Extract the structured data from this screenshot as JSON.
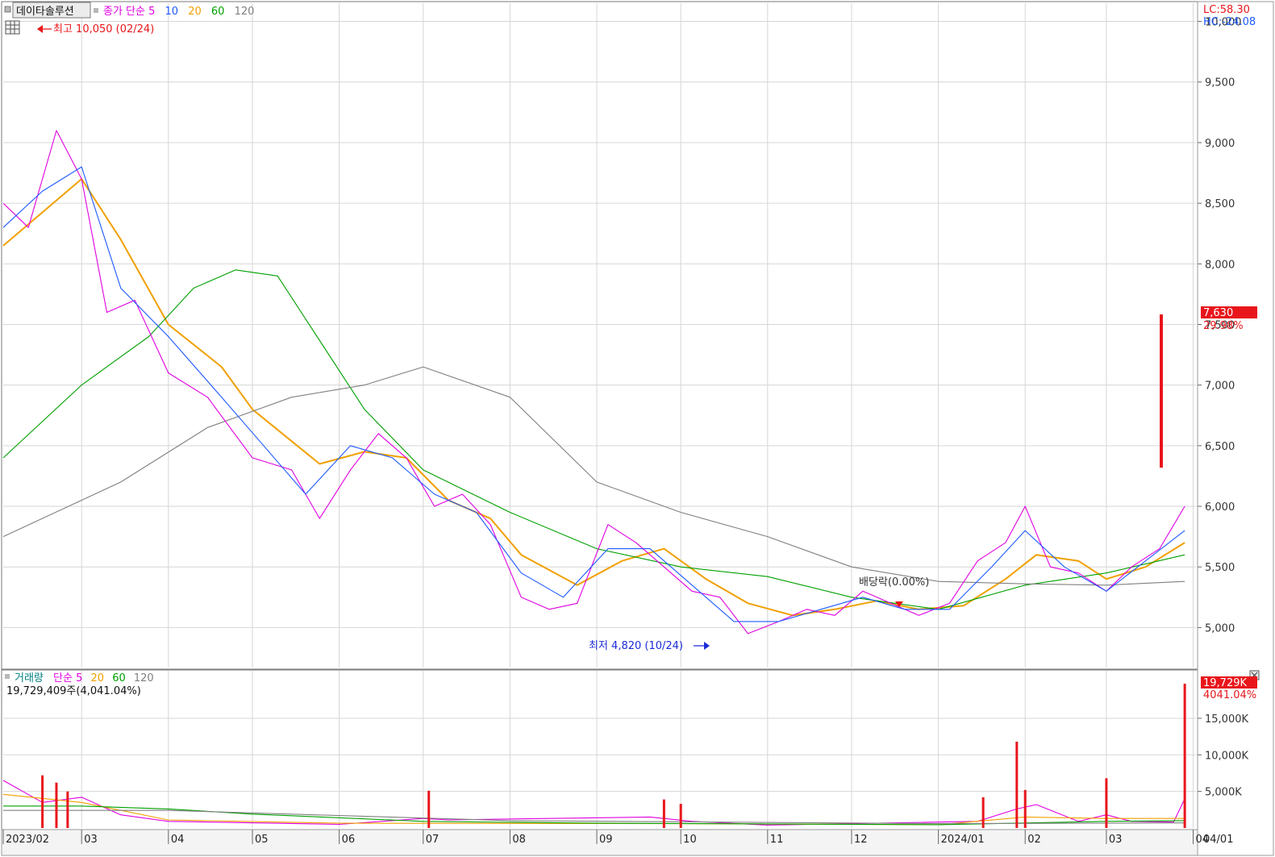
{
  "header": {
    "stock_name": "데이타솔루션",
    "price_legend": [
      {
        "text": "종가 단순 5",
        "color": "#e000e0"
      },
      {
        "text": "10",
        "color": "#1e5aff"
      },
      {
        "text": "20",
        "color": "#f0a000"
      },
      {
        "text": "60",
        "color": "#00a000"
      },
      {
        "text": "120",
        "color": "#808080"
      }
    ],
    "lc_label": "LC:58.30",
    "hc_label": "HC:-24.08"
  },
  "volume_header": {
    "legend": [
      {
        "text": "거래량",
        "color": "#008080"
      },
      {
        "text": "단순 5",
        "color": "#e000e0"
      },
      {
        "text": "20",
        "color": "#f0a000"
      },
      {
        "text": "60",
        "color": "#00a000"
      },
      {
        "text": "120",
        "color": "#808080"
      }
    ],
    "total": "19,729,409주(4,041.04%)"
  },
  "annotations": {
    "high": "최고 10,050 (02/24)",
    "low": "최저 4,820 (10/24)",
    "dividend": "배당락(0.00%)"
  },
  "price_tag": {
    "price": "7,630",
    "change": "29.98%"
  },
  "volume_tag": {
    "volume": "19,729K",
    "ratio": "4041.04%"
  },
  "colors": {
    "up": "#e8161b",
    "down": "#1a44d8",
    "ma5": "#e000e0",
    "ma10": "#1e5aff",
    "ma20": "#f0a000",
    "ma60": "#00a000",
    "ma120": "#808080"
  },
  "chart_data": [
    {
      "type": "line",
      "panel": "price",
      "y_ticks": [
        5000,
        5500,
        6000,
        6500,
        7000,
        7500,
        8000,
        8500,
        9000,
        9500,
        10000
      ],
      "y_tick_labels": [
        "5,000",
        "5,500",
        "6,000",
        "6,500",
        "7,000",
        "7,500",
        "8,000",
        "8,500",
        "9,000",
        "9,500",
        "10,000"
      ],
      "ylim": [
        4670,
        10150
      ],
      "x_ticks": [
        "2023/02",
        "03",
        "04",
        "05",
        "06",
        "07",
        "08",
        "09",
        "10",
        "11",
        "12",
        "2024/01",
        "02",
        "03",
        "04",
        "04/01"
      ],
      "series": [
        {
          "key": "ma20",
          "x": [
            "2023-02-01",
            "2023-03-01",
            "2023-03-15",
            "2023-04-01",
            "2023-04-20",
            "2023-05-01",
            "2023-05-25",
            "2023-06-10",
            "2023-06-25",
            "2023-07-10",
            "2023-07-25",
            "2023-08-05",
            "2023-08-25",
            "2023-09-10",
            "2023-09-25",
            "2023-10-10",
            "2023-10-25",
            "2023-11-10",
            "2023-11-25",
            "2023-12-10",
            "2023-12-25",
            "2024-01-10",
            "2024-01-25",
            "2024-02-05",
            "2024-02-20",
            "2024-03-01",
            "2024-03-15",
            "2024-03-29"
          ],
          "y": [
            8150,
            8700,
            8200,
            7500,
            7150,
            6800,
            6350,
            6450,
            6400,
            6050,
            5900,
            5600,
            5350,
            5550,
            5650,
            5400,
            5200,
            5100,
            5150,
            5220,
            5150,
            5180,
            5400,
            5600,
            5550,
            5400,
            5500,
            5700
          ]
        },
        {
          "key": "ma60",
          "x": [
            "2023-02-01",
            "2023-03-01",
            "2023-03-25",
            "2023-04-10",
            "2023-04-25",
            "2023-05-10",
            "2023-06-10",
            "2023-07-01",
            "2023-08-01",
            "2023-09-01",
            "2023-10-01",
            "2023-11-01",
            "2023-12-01",
            "2024-01-01",
            "2024-02-01",
            "2024-03-01",
            "2024-03-29"
          ],
          "y": [
            6400,
            7000,
            7400,
            7800,
            7950,
            7900,
            6800,
            6300,
            5950,
            5650,
            5500,
            5420,
            5250,
            5150,
            5350,
            5450,
            5600
          ]
        },
        {
          "key": "ma120",
          "x": [
            "2023-02-01",
            "2023-03-15",
            "2023-04-15",
            "2023-05-15",
            "2023-06-10",
            "2023-07-01",
            "2023-08-01",
            "2023-09-01",
            "2023-10-01",
            "2023-11-01",
            "2023-12-01",
            "2024-01-01",
            "2024-02-01",
            "2024-03-01",
            "2024-03-29"
          ],
          "y": [
            5750,
            6200,
            6650,
            6900,
            7000,
            7150,
            6900,
            6200,
            5950,
            5750,
            5500,
            5380,
            5360,
            5350,
            5380
          ]
        },
        {
          "key": "ma5",
          "x": [
            "2023-02-01",
            "2023-02-10",
            "2023-02-20",
            "2023-03-01",
            "2023-03-10",
            "2023-03-20",
            "2023-04-01",
            "2023-04-15",
            "2023-05-01",
            "2023-05-15",
            "2023-05-25",
            "2023-06-05",
            "2023-06-15",
            "2023-06-25",
            "2023-07-05",
            "2023-07-15",
            "2023-07-25",
            "2023-08-05",
            "2023-08-15",
            "2023-08-25",
            "2023-09-05",
            "2023-09-15",
            "2023-09-25",
            "2023-10-05",
            "2023-10-15",
            "2023-10-25",
            "2023-11-05",
            "2023-11-15",
            "2023-11-25",
            "2023-12-05",
            "2023-12-15",
            "2023-12-25",
            "2024-01-05",
            "2024-01-15",
            "2024-01-25",
            "2024-02-01",
            "2024-02-10",
            "2024-02-20",
            "2024-03-01",
            "2024-03-10",
            "2024-03-20",
            "2024-03-29"
          ],
          "y": [
            8500,
            8300,
            9100,
            8700,
            7600,
            7700,
            7100,
            6900,
            6400,
            6300,
            5900,
            6300,
            6600,
            6400,
            6000,
            6100,
            5850,
            5250,
            5150,
            5200,
            5850,
            5700,
            5500,
            5300,
            5250,
            4950,
            5050,
            5150,
            5100,
            5300,
            5200,
            5100,
            5200,
            5550,
            5700,
            6000,
            5500,
            5450,
            5300,
            5500,
            5650,
            6000
          ]
        },
        {
          "key": "ma10",
          "x": [
            "2023-02-01",
            "2023-02-15",
            "2023-03-01",
            "2023-03-15",
            "2023-04-01",
            "2023-04-20",
            "2023-05-05",
            "2023-05-20",
            "2023-06-05",
            "2023-06-20",
            "2023-07-05",
            "2023-07-20",
            "2023-08-05",
            "2023-08-20",
            "2023-09-05",
            "2023-09-20",
            "2023-10-05",
            "2023-10-20",
            "2023-11-05",
            "2023-11-20",
            "2023-12-05",
            "2023-12-20",
            "2024-01-05",
            "2024-01-20",
            "2024-02-01",
            "2024-02-15",
            "2024-03-01",
            "2024-03-15",
            "2024-03-29"
          ],
          "y": [
            8300,
            8600,
            8800,
            7800,
            7400,
            6900,
            6500,
            6100,
            6500,
            6400,
            6100,
            5950,
            5450,
            5250,
            5650,
            5650,
            5350,
            5050,
            5050,
            5150,
            5250,
            5150,
            5150,
            5500,
            5800,
            5500,
            5300,
            5550,
            5800
          ]
        }
      ],
      "annotations": [
        {
          "label": "high",
          "x": "2023-02-24",
          "y": 10050
        },
        {
          "label": "low",
          "x": "2023-10-24",
          "y": 4820
        },
        {
          "label": "dividend",
          "x": "2023-12-27",
          "y": 5180
        }
      ],
      "last_close": 7630
    },
    {
      "type": "bar",
      "panel": "volume",
      "y_ticks": [
        5000,
        10000,
        15000
      ],
      "y_tick_labels": [
        "5,000K",
        "10,000K",
        "15,000K"
      ],
      "ylim": [
        0,
        21500
      ],
      "unit": "K",
      "spikes": [
        {
          "x": "2023-02-15",
          "v": 7200
        },
        {
          "x": "2023-02-20",
          "v": 6200
        },
        {
          "x": "2023-02-24",
          "v": 5000
        },
        {
          "x": "2023-07-03",
          "v": 5100
        },
        {
          "x": "2023-09-25",
          "v": 3900
        },
        {
          "x": "2023-10-01",
          "v": 3300
        },
        {
          "x": "2024-01-17",
          "v": 4200
        },
        {
          "x": "2024-01-29",
          "v": 11800
        },
        {
          "x": "2024-02-01",
          "v": 5200
        },
        {
          "x": "2024-03-01",
          "v": 6800
        },
        {
          "x": "2024-03-29",
          "v": 19729
        }
      ],
      "series": [
        {
          "key": "ma5",
          "x": [
            "2023-02-01",
            "2023-02-15",
            "2023-03-01",
            "2023-03-15",
            "2023-04-01",
            "2023-06-01",
            "2023-07-01",
            "2023-07-10",
            "2023-09-20",
            "2023-10-05",
            "2023-11-01",
            "2024-01-15",
            "2024-01-29",
            "2024-02-05",
            "2024-02-20",
            "2024-03-01",
            "2024-03-10",
            "2024-03-25",
            "2024-03-29"
          ],
          "y": [
            6500,
            3500,
            4200,
            1800,
            900,
            500,
            1300,
            1100,
            1500,
            900,
            400,
            900,
            2600,
            3200,
            900,
            1800,
            900,
            800,
            4000
          ]
        },
        {
          "key": "ma20",
          "x": [
            "2023-02-01",
            "2023-03-01",
            "2023-04-01",
            "2023-06-01",
            "2023-10-01",
            "2024-01-01",
            "2024-02-01",
            "2024-03-01",
            "2024-03-29"
          ],
          "y": [
            4600,
            3500,
            1100,
            650,
            600,
            450,
            1500,
            1300,
            1300
          ]
        },
        {
          "key": "ma60",
          "x": [
            "2023-02-01",
            "2023-03-01",
            "2023-04-01",
            "2023-05-01",
            "2023-07-01",
            "2023-09-01",
            "2024-01-01",
            "2024-03-01",
            "2024-03-29"
          ],
          "y": [
            3000,
            3000,
            2600,
            1900,
            900,
            650,
            450,
            900,
            1000
          ]
        },
        {
          "key": "ma120",
          "x": [
            "2023-02-01",
            "2023-04-01",
            "2023-06-01",
            "2023-08-01",
            "2024-01-01",
            "2024-03-29"
          ],
          "y": [
            2400,
            2400,
            1700,
            1000,
            600,
            700
          ]
        }
      ]
    }
  ]
}
